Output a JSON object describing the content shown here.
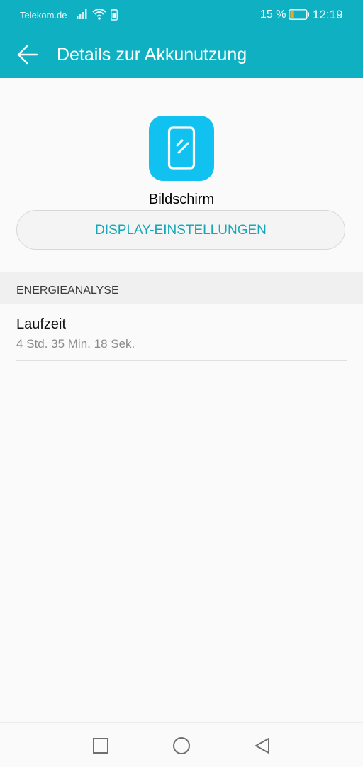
{
  "status_bar": {
    "carrier": "Telekom.de",
    "battery_percent": "15 %",
    "time": "12:19",
    "icons": [
      "signal-icon",
      "wifi-icon",
      "battery-small-icon",
      "battery-icon"
    ]
  },
  "header": {
    "title": "Details zur Akkunutzung",
    "back_icon": "arrow-left-icon"
  },
  "app": {
    "name": "Bildschirm",
    "icon": "phone-screen-icon"
  },
  "display_button": {
    "label": "DISPLAY-EINSTELLUNGEN"
  },
  "energy_section": {
    "title": "ENERGIEANALYSE",
    "runtime_label": "Laufzeit",
    "runtime_value": "4 Std. 35 Min. 18 Sek."
  },
  "nav_bar": {
    "icons": [
      "square-icon",
      "circle-icon",
      "triangle-back-icon"
    ]
  },
  "colors": {
    "accent": "#0fb0c1",
    "app_icon": "#11c1ef",
    "battery_fill": "#f4a418"
  }
}
